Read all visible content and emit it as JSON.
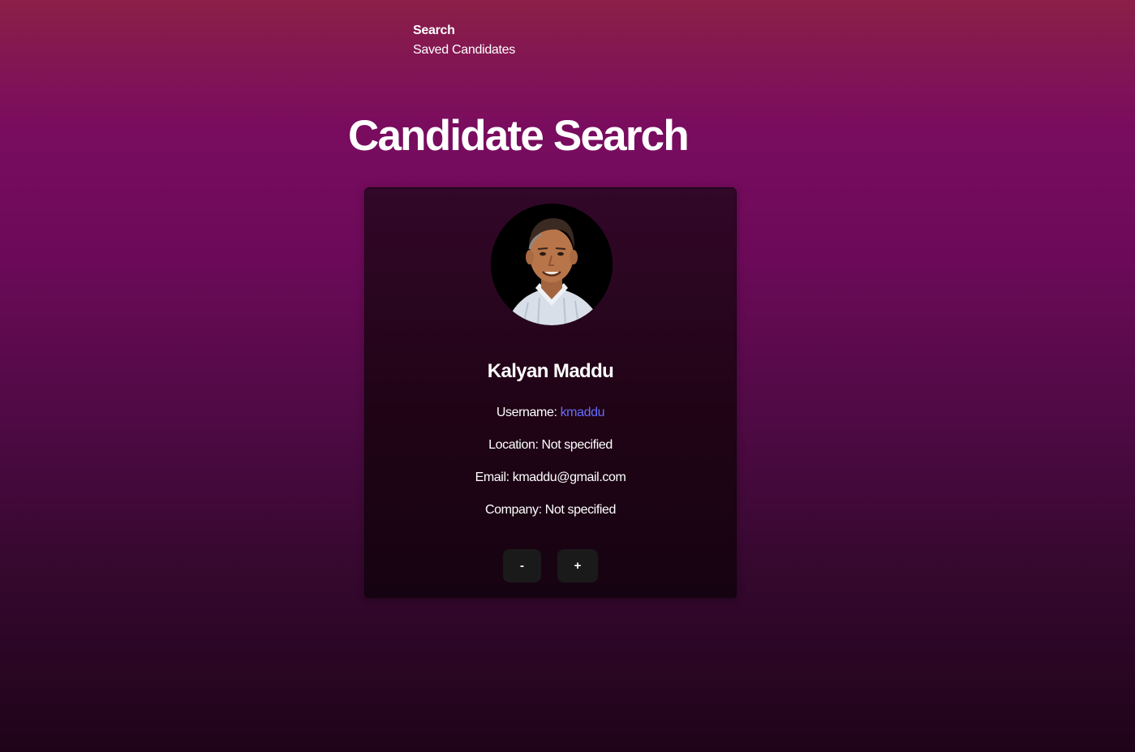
{
  "nav": {
    "items": [
      {
        "label": "Search"
      },
      {
        "label": "Saved Candidates"
      }
    ]
  },
  "page": {
    "title": "Candidate Search"
  },
  "candidate": {
    "name": "Kalyan Maddu",
    "username_label": "Username:",
    "username": "kmaddu",
    "location_label": "Location:",
    "location": "Not specified",
    "email_label": "Email:",
    "email": "kmaddu@gmail.com",
    "company_label": "Company:",
    "company": "Not specified",
    "avatar_alt": "Kalyan Maddu"
  },
  "actions": {
    "reject_label": "-",
    "save_label": "+"
  },
  "colors": {
    "link": "#646cff",
    "button_bg": "#1a1a1a",
    "card_bg": "#200416"
  }
}
